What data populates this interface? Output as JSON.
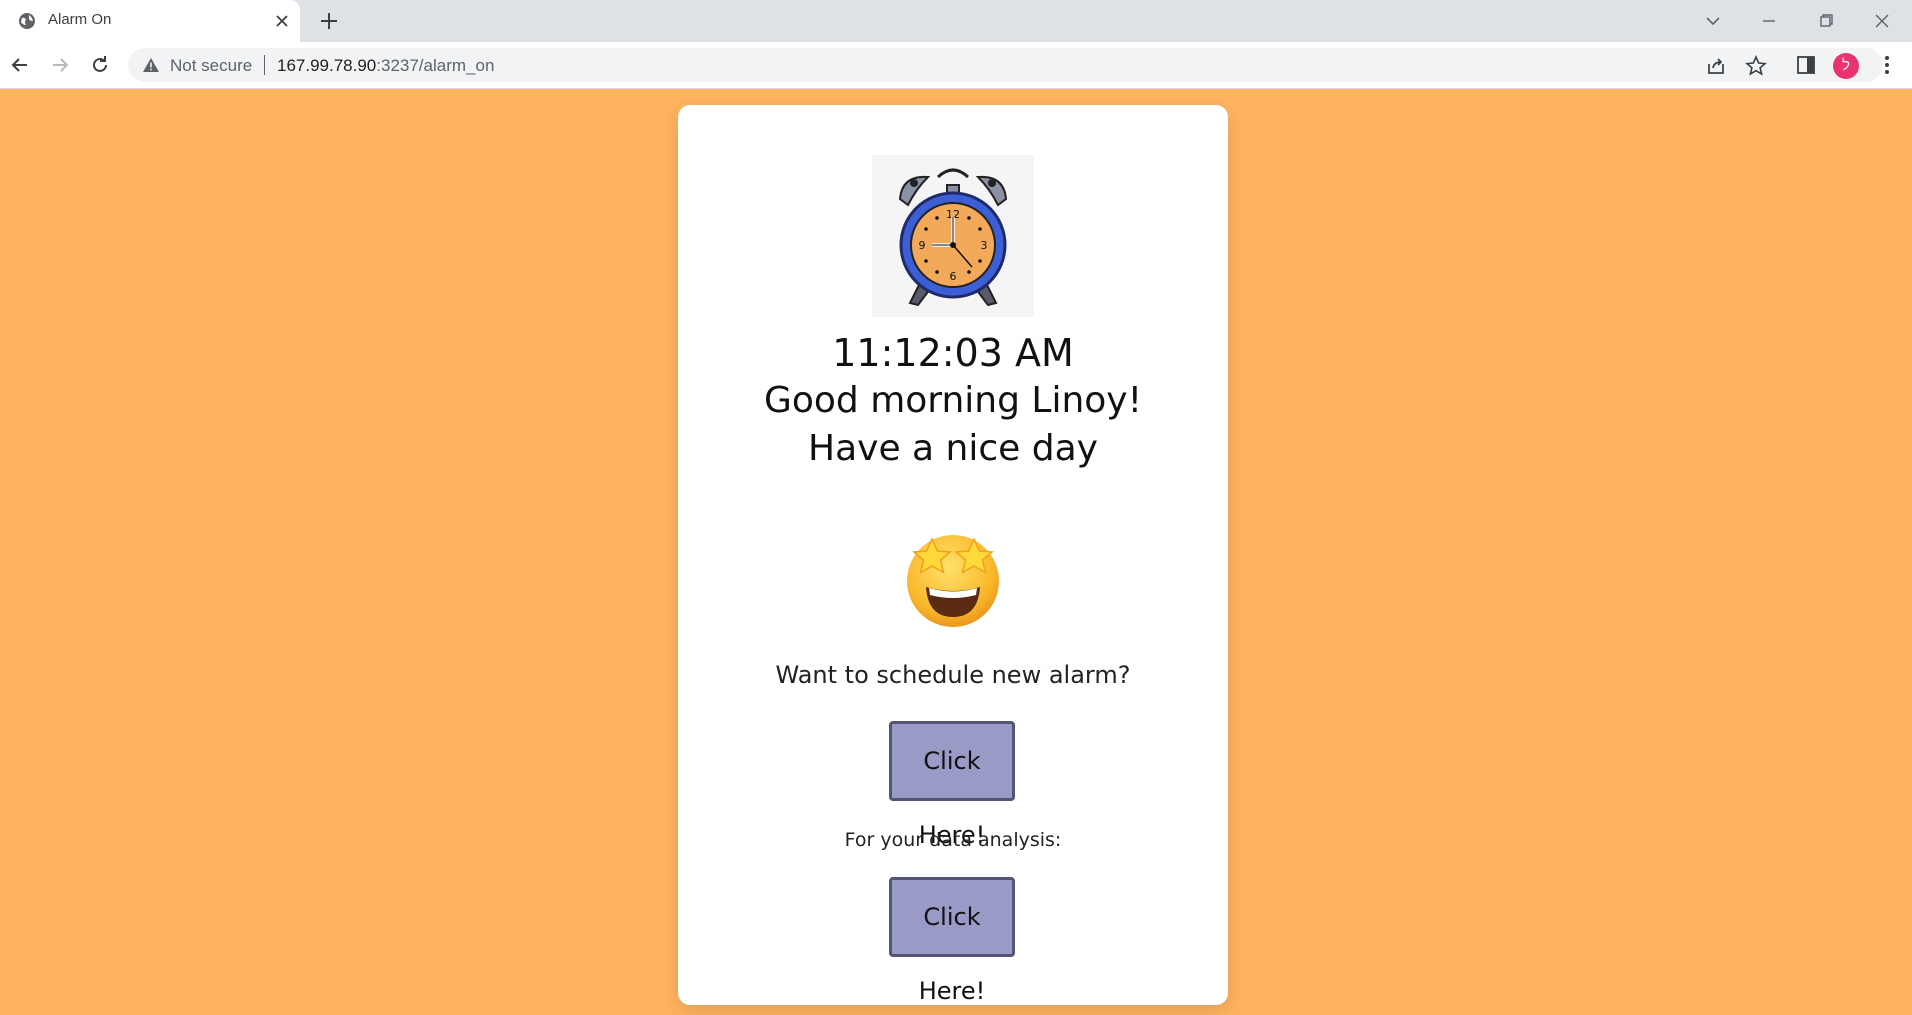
{
  "browser": {
    "tab_title": "Alarm On",
    "security_label": "Not secure",
    "url_host": "167.99.78.90",
    "url_rest": ":3237/alarm_on",
    "profile_initial": "ל"
  },
  "page": {
    "time": "11:12:03 AM",
    "greeting": "Good morning Linoy! Have a nice day",
    "emoji": "star-struck",
    "schedule_prompt": "Want to schedule new alarm?",
    "schedule_button": "Click Here!",
    "analysis_prompt": "For your data analysis:",
    "analysis_button": "Click Here!"
  },
  "colors": {
    "page_background": "#ffb35f",
    "card_background": "#ffffff",
    "button_fill": "#9a9ac6",
    "button_border": "#55557a",
    "profile_avatar": "#e8336e"
  }
}
